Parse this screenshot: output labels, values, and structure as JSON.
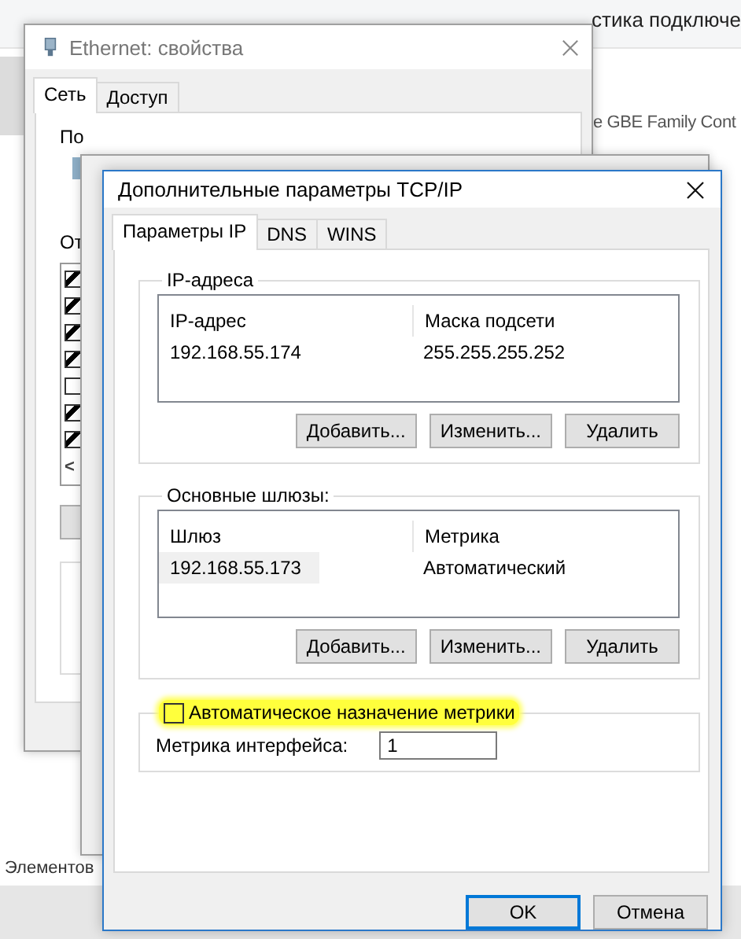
{
  "explorer": {
    "toolbar_text": "стика подключе",
    "adapter_text": "e GBE Family Cont",
    "status_text": "Элементов"
  },
  "ethernet_window": {
    "title": "Ethernet: свойства",
    "tabs": [
      {
        "label": "Сеть",
        "selected": true
      },
      {
        "label": "Доступ",
        "selected": false
      }
    ],
    "label_top": "По",
    "label_components": "От",
    "components": [
      {
        "checked": true
      },
      {
        "checked": true
      },
      {
        "checked": true
      },
      {
        "checked": true
      },
      {
        "checked": false
      },
      {
        "checked": true
      },
      {
        "checked": true
      }
    ],
    "scroll_arrow": "<"
  },
  "dialog": {
    "title": "Дополнительные параметры TCP/IP",
    "tabs": [
      {
        "label": "Параметры IP",
        "selected": true
      },
      {
        "label": "DNS",
        "selected": false
      },
      {
        "label": "WINS",
        "selected": false
      }
    ],
    "groups": [
      {
        "title": "IP-адреса",
        "columns": [
          "IP-адрес",
          "Маска подсети"
        ],
        "rows": [
          {
            "cells": [
              "192.168.55.174",
              "255.255.255.252"
            ],
            "selected": false
          }
        ],
        "buttons": [
          "Добавить...",
          "Изменить...",
          "Удалить"
        ]
      },
      {
        "title": "Основные шлюзы:",
        "columns": [
          "Шлюз",
          "Метрика"
        ],
        "rows": [
          {
            "cells": [
              "192.168.55.173",
              "Автоматический"
            ],
            "selected": true
          }
        ],
        "buttons": [
          "Добавить...",
          "Изменить...",
          "Удалить"
        ]
      }
    ],
    "auto_metric": {
      "label": "Автоматическое назначение метрики",
      "checked": false,
      "highlighted": true
    },
    "interface_metric": {
      "label": "Метрика интерфейса:",
      "value": "1"
    },
    "buttons": [
      {
        "label": "OK",
        "default": true
      },
      {
        "label": "Отмена",
        "default": false
      }
    ]
  }
}
